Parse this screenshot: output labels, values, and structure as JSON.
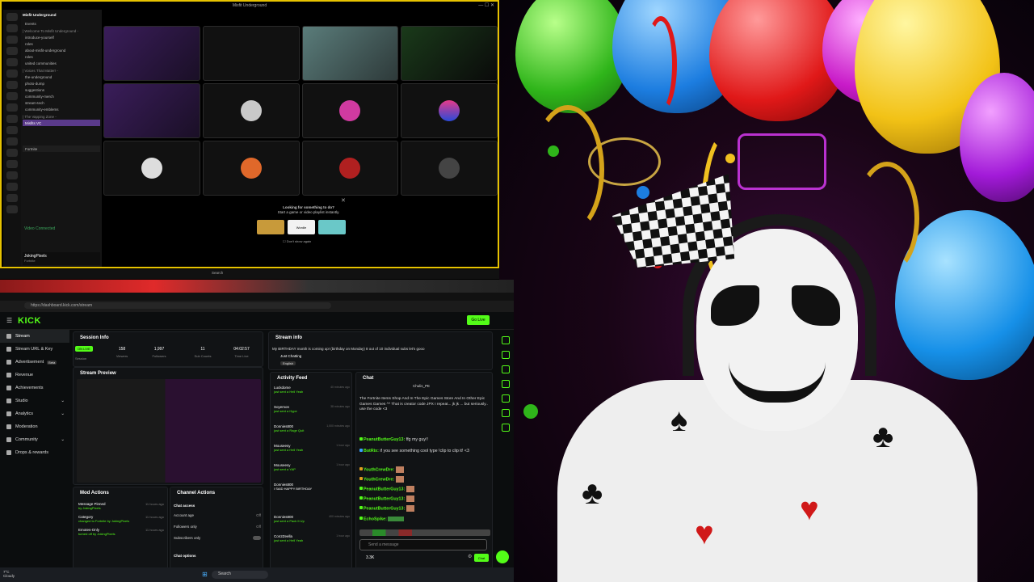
{
  "discord": {
    "window_title": "Misfit Underground",
    "server_name": "Misfit Underground",
    "sidebar_items": [
      "Events",
      "| Welcome To Misfit Underground -",
      "introduce-yourself",
      "roles",
      "about-misfit-underground",
      "roles",
      "united communities",
      "| Voices That Matter! -",
      "the-underground",
      "photo-dump",
      "suggestions",
      "community-merch",
      "stream-tech",
      "community-emblems",
      "| The Vapping Zone -",
      "Misfits VC"
    ],
    "status_text": "Fortnite",
    "voice_status": "Video Connected",
    "user_name": "JokingPixels",
    "user_status": "Fortnite",
    "empty_prompt_title": "Looking for something to do?",
    "empty_prompt_sub": "Start a game or video playlist instantly.",
    "activity_buttons": [
      "",
      "Wordle",
      ""
    ],
    "dont_show": "Don't show again",
    "taskbar_search": "Search"
  },
  "browser": {
    "url": "https://dashboard.kick.com/stream"
  },
  "kick": {
    "logo": "KICK",
    "go_live": "Go Live",
    "nav": [
      {
        "label": "Stream",
        "active": true,
        "badge": ""
      },
      {
        "label": "Stream URL & Key",
        "active": false,
        "badge": ""
      },
      {
        "label": "Advertisement",
        "active": false,
        "badge": "Beta"
      },
      {
        "label": "Revenue",
        "active": false,
        "badge": ""
      },
      {
        "label": "Achievements",
        "active": false,
        "badge": ""
      },
      {
        "label": "Studio",
        "active": false,
        "badge": ""
      },
      {
        "label": "Analytics",
        "active": false,
        "badge": ""
      },
      {
        "label": "Moderation",
        "active": false,
        "badge": ""
      },
      {
        "label": "Community",
        "active": false,
        "badge": ""
      },
      {
        "label": "Drops & rewards",
        "active": false,
        "badge": ""
      }
    ],
    "session": {
      "title": "Session Info",
      "live": "ON LIVE",
      "stats": [
        {
          "value": "158",
          "label": "Viewers"
        },
        {
          "value": "1,997",
          "label": "Followers"
        },
        {
          "value": "11",
          "label": "Sub Counts"
        },
        {
          "value": "04:02:57",
          "label": "Time Live"
        }
      ],
      "session_label": "Session"
    },
    "preview": {
      "title": "Stream Preview"
    },
    "mod_actions": {
      "title": "Mod Actions",
      "rows": [
        {
          "title": "Message Pinned",
          "sub": "by JokingPixels",
          "time": "11 hours ago"
        },
        {
          "title": "Category",
          "sub": "changed to Fortnite by JokingPixels",
          "time": "11 hours ago"
        },
        {
          "title": "Emotes-Only",
          "sub": "turned off by JokingPixels",
          "time": "11 hours ago"
        }
      ]
    },
    "channel_actions": {
      "title": "Channel Actions",
      "chat_access": "Chat access",
      "rows": [
        {
          "label": "Account age",
          "value": "Off"
        },
        {
          "label": "Followers only",
          "value": "Off"
        },
        {
          "label": "Subscribers only",
          "value": ""
        }
      ],
      "chat_options": "Chat options"
    },
    "stream_info": {
      "title": "Stream info",
      "stream_title": "My BIRTHDAY month is coming up! (birthday on Monday) 8 out of 10 individual subs let's gooo",
      "category": "Just Chatting",
      "language": "English"
    },
    "activity": {
      "title": "Activity Feed",
      "items": [
        {
          "user": "Luckdome",
          "what": "just sent a Hell Yeah",
          "time": "40 minutes ago"
        },
        {
          "user": "Soyemon",
          "what": "just sent a Hype",
          "time": "38 minutes ago"
        },
        {
          "user": "Donnies800",
          "what": "just sent a Rage Quit",
          "time": "1,000 minutes ago"
        },
        {
          "user": "Mouseesy",
          "what": "just sent a Hell Yeah",
          "time": "1 hour ago"
        },
        {
          "user": "Mouseesy",
          "what": "just sent a YAP",
          "time": "1 hour ago"
        },
        {
          "user": "Donnies800",
          "what": "I SAID HAPPY BIRTHDAY",
          "time": ""
        },
        {
          "user": "Donnies800",
          "what": "just sent a Pack It Up",
          "time": "400 minutes ago"
        },
        {
          "user": "Con2Zeella",
          "what": "just sent a Hell Yeah",
          "time": "1 hour ago"
        }
      ]
    },
    "chat": {
      "title": "Chat",
      "pinned_user": "Chulis_PE",
      "pinned_text": "The Fortnite Items Shop And In The Epic Games Store And In Other Epic Games Games ^^ That is creator code JPX I repeat... jk jk ... but seriously.. use the code <3",
      "messages": [
        {
          "user": "PeanutButterGuy13:",
          "text": "ffg my guy!!",
          "color": "#53fc18"
        },
        {
          "user": "BotRix:",
          "text": "if you see something cool type !clip to clip it! <3",
          "color": "#53fc18"
        },
        {
          "user": "YouthCrewDre:",
          "text": "",
          "color": "#53fc18"
        },
        {
          "user": "YouthCrewDre:",
          "text": "",
          "color": "#53fc18"
        },
        {
          "user": "PeanutButterGuy13:",
          "text": "",
          "color": "#53fc18"
        },
        {
          "user": "PeanutButterGuy13:",
          "text": "",
          "color": "#53fc18"
        },
        {
          "user": "PeanutButterGuy13:",
          "text": "",
          "color": "#53fc18"
        },
        {
          "user": "EchoSpike:",
          "text": "",
          "color": "#53fc18"
        }
      ],
      "input_placeholder": "Send a message",
      "viewer_count": "3.3K",
      "send_label": "Chat"
    }
  },
  "taskbar": {
    "search": "Search",
    "weather_temp": "7°C",
    "weather_text": "Cloudy"
  },
  "colors": {
    "kick_green": "#53fc18",
    "discord_border": "#e6c200"
  }
}
